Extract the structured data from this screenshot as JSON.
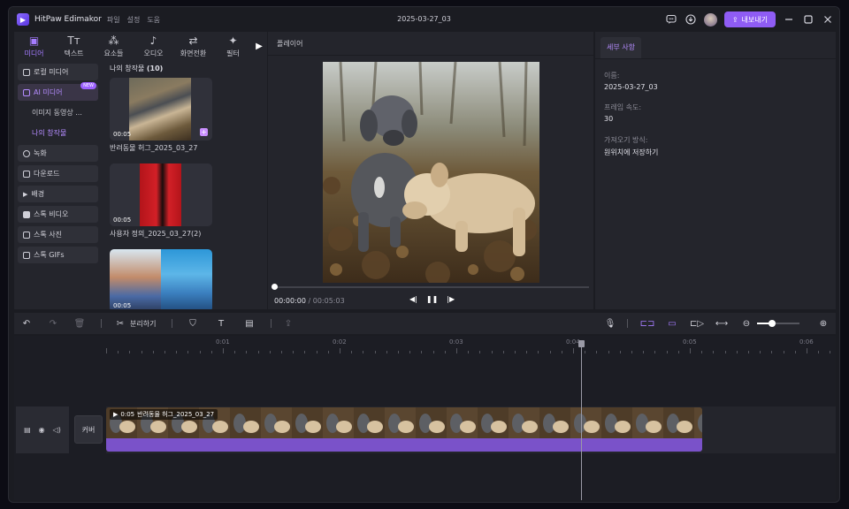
{
  "app": {
    "name": "HitPaw Edimakor",
    "menu": [
      "파일",
      "설정",
      "도움"
    ],
    "window_title": "2025-03-27_03",
    "export_label": "내보내기",
    "accent": "#8f5cf5"
  },
  "top_tabs": [
    {
      "label": "미디어",
      "icon": "media-icon",
      "active": true
    },
    {
      "label": "텍스트",
      "icon": "text-icon"
    },
    {
      "label": "요소들",
      "icon": "elements-icon"
    },
    {
      "label": "오디오",
      "icon": "audio-icon"
    },
    {
      "label": "화면전환",
      "icon": "transition-icon"
    },
    {
      "label": "필터",
      "icon": "filter-icon"
    }
  ],
  "sidebar": {
    "items": [
      {
        "label": "로컬 미디어"
      },
      {
        "label": "AI 미디어",
        "badge": "NEW"
      },
      {
        "label": "이미지 동영상 ..."
      },
      {
        "label": "나의 창작물"
      },
      {
        "label": "녹화"
      },
      {
        "label": "다운로드"
      },
      {
        "label": "배경"
      },
      {
        "label": "스톡 비디오"
      },
      {
        "label": "스톡 사진"
      },
      {
        "label": "스톡 GIFs"
      }
    ]
  },
  "media": {
    "heading": "나의 창작물",
    "count": "(10)",
    "cards": [
      {
        "duration": "00:05",
        "title": "반려동물 허그_2025_03_27"
      },
      {
        "duration": "00:05",
        "title": "사용자 정의_2025_03_27(2)"
      },
      {
        "duration": "00:05",
        "title": ""
      }
    ]
  },
  "player": {
    "heading": "플레이어",
    "current_time": "00:00:00",
    "separator": "/",
    "total_time": "00:05:03",
    "progress": 0
  },
  "details": {
    "tab": "세부 사항",
    "name_label": "이름:",
    "name_value": "2025-03-27_03",
    "fps_label": "프레임 속도:",
    "fps_value": "30",
    "import_label": "가져오기 방식:",
    "import_value": "원위치에 저장하기"
  },
  "toolbar": {
    "split_label": "분리하기"
  },
  "timeline": {
    "ruler": [
      "0:01",
      "0:02",
      "0:03",
      "0:04",
      "0:05",
      "0:06"
    ],
    "cover_label": "커버",
    "clip_time": "0:05",
    "clip_title": "반려동물 허그_2025_03_27",
    "zoom_level": 0.35
  }
}
